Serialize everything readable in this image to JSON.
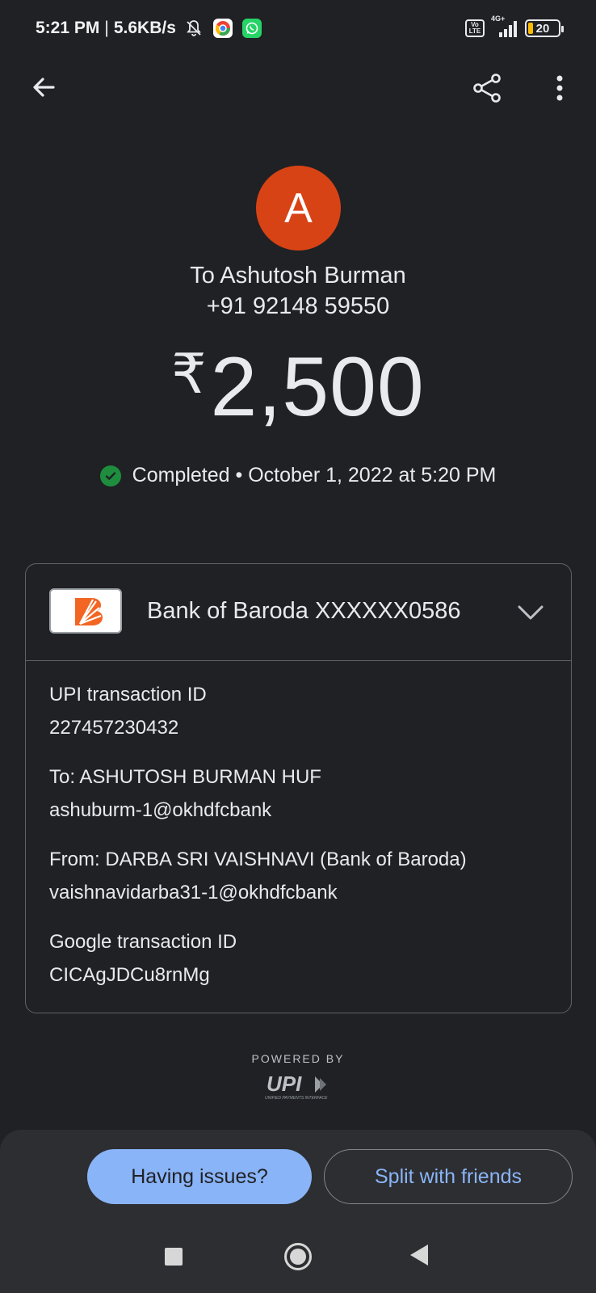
{
  "status_bar": {
    "time": "5:21 PM",
    "separator": "|",
    "speed": "5.6KB/s",
    "network_type": "4G+",
    "volte_line1": "Vo",
    "volte_line2": "LTE",
    "battery": "20",
    "icons": [
      "bell-off-icon",
      "chrome-icon",
      "whatsapp-icon",
      "volte-icon",
      "signal-icon",
      "battery-icon"
    ]
  },
  "app_bar": {
    "icons": [
      "back-arrow-icon",
      "share-icon",
      "more-vert-icon"
    ]
  },
  "recipient": {
    "initial": "A",
    "name": "To Ashutosh Burman",
    "phone": "+91 92148 59550",
    "avatar_color": "#d84315"
  },
  "amount": {
    "currency_symbol": "₹",
    "value": "2,500"
  },
  "status": {
    "label": "Completed",
    "separator": "•",
    "datetime": "October 1, 2022 at 5:20 PM",
    "color": "#1e8e3e"
  },
  "bank": {
    "name": "Bank of Baroda XXXXXX0586",
    "logo_color": "#f26522"
  },
  "details": {
    "upi_label": "UPI transaction ID",
    "upi_value": "227457230432",
    "to_label": "To: ASHUTOSH BURMAN HUF",
    "to_value": "ashuburm-1@okhdfcbank",
    "from_label": "From: DARBA SRI VAISHNAVI (Bank of Baroda)",
    "from_value": "vaishnavidarba31-1@okhdfcbank",
    "google_label": "Google transaction ID",
    "google_value": "CICAgJDCu8rnMg"
  },
  "powered_by": {
    "label": "POWERED BY",
    "logo_text": "UPI",
    "logo_subtext": "UNIFIED PAYMENTS INTERFACE"
  },
  "actions": {
    "issues_label": "Having issues?",
    "split_label": "Split with friends",
    "accent": "#8ab4f8"
  }
}
